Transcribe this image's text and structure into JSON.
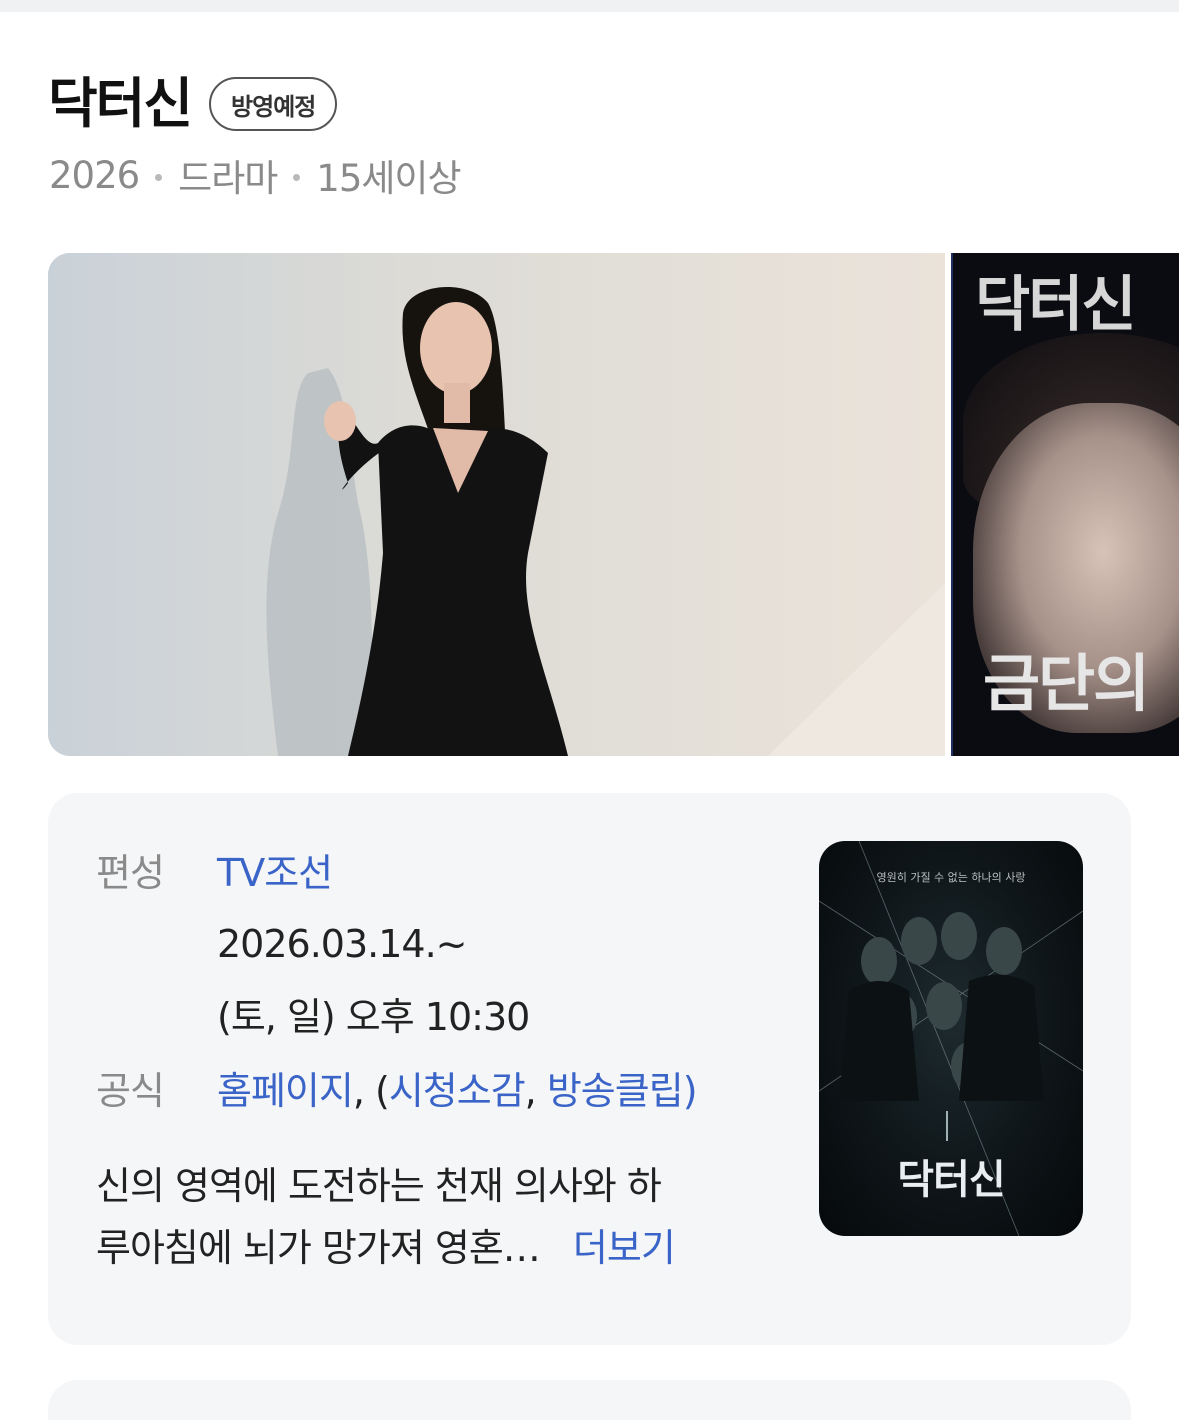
{
  "header": {
    "title": "닥터신",
    "badge": "방영예정",
    "meta": [
      "2026",
      "드라마",
      "15세이상"
    ]
  },
  "gallery": {
    "side_image": {
      "text_top": "닥터신",
      "text_bottom": "금단의"
    }
  },
  "info": {
    "broadcast_label": "편성",
    "broadcaster": "TV조선",
    "date": "2026.03.14.~",
    "schedule": "(토, 일) 오후 10:30",
    "official_label": "공식",
    "official_links": {
      "homepage": "홈페이지",
      "sep1": ", (",
      "reviews": "시청소감",
      "sep2": ", ",
      "clips": "방송클립",
      "close": ")"
    },
    "description_line1": "신의 영역에 도전하는 천재 의사와 하",
    "description_line2": "루아침에 뇌가 망가져 영혼…",
    "more": "더보기",
    "poster": {
      "tagline": "영원히 가질 수 없는 하나의 사랑",
      "title": "닥터신"
    }
  }
}
